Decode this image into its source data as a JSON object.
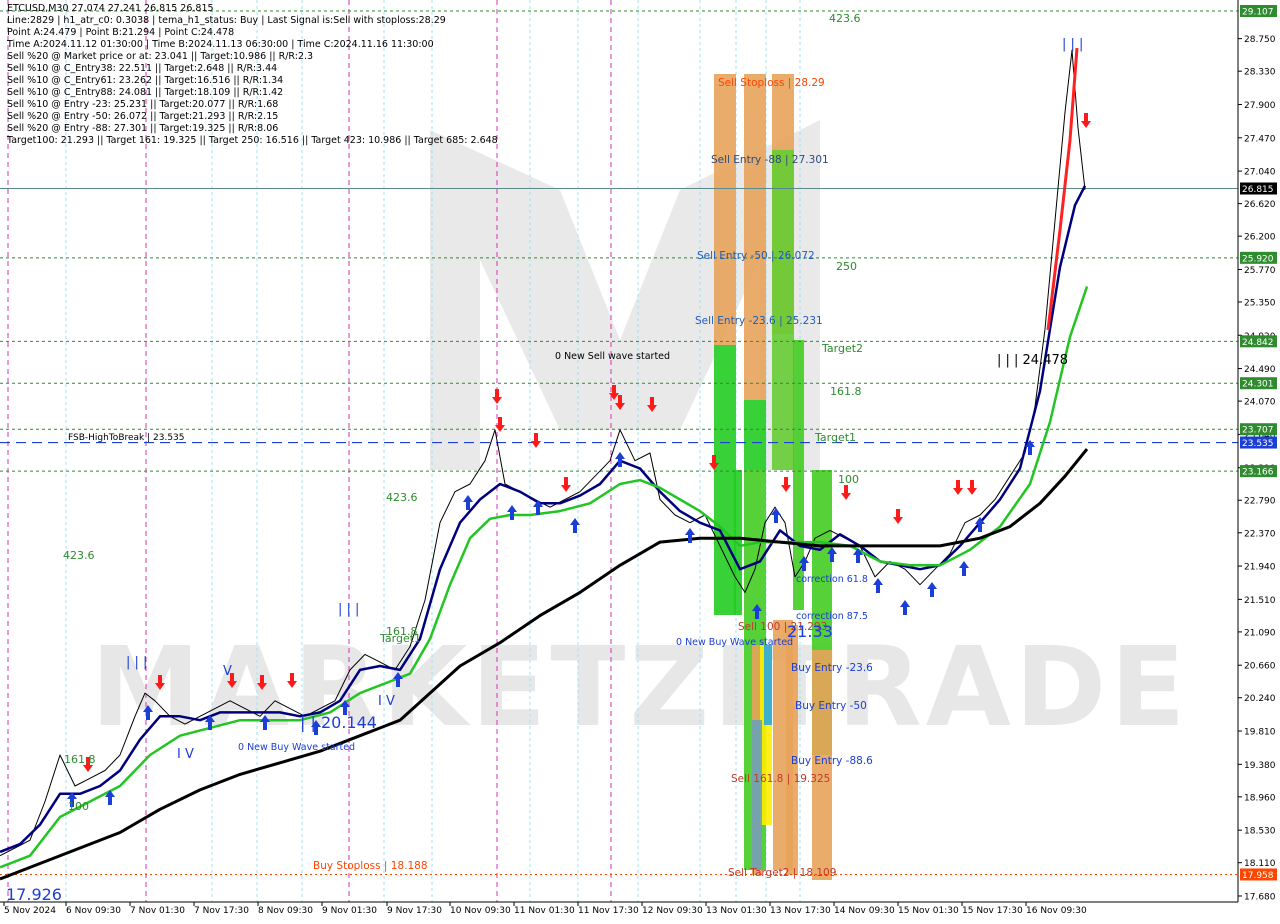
{
  "info_lines": [
    "ETCUSD,M30  27.074 27.241 26.815 26.815",
    "Line:2829  |  h1_atr_c0: 0.3038  |  tema_h1_status: Buy  |  Last Signal is:Sell with stoploss:28.29",
    "Point A:24.479  |  Point B:21.294  |  Point C:24.478",
    "Time A:2024.11.12 01:30:00  |  Time B:2024.11.13 06:30:00  |  Time C:2024.11.16 11:30:00",
    "Sell %20 @ Market price or at: 23.041  ||  Target:10.986  ||  R/R:2.3",
    "Sell %10 @ C_Entry38: 22.511  ||  Target:2.648  ||  R/R:3.44",
    "Sell %10 @ C_Entry61: 23.262  ||  Target:16.516  ||  R/R:1.34",
    "Sell %10 @ C_Entry88: 24.081  ||  Target:18.109  ||  R/R:1.42",
    "Sell %10 @ Entry -23: 25.231  ||  Target:20.077  ||  R/R:1.68",
    "Sell %20 @ Entry -50: 26.072  ||  Target:21.293  ||  R/R:2.15",
    "Sell %20 @ Entry -88: 27.301  ||  Target:19.325  ||  R/R:8.06",
    "Target100: 21.293  ||  Target 161: 19.325  ||  Target 250: 16.516  ||  Target 423: 10.986  ||  Target 685: 2.648"
  ],
  "chart_data": {
    "type": "line",
    "symbol": "ETCUSD,M30",
    "ylim": [
      17.68,
      29.107
    ],
    "y_ticks": [
      "28.750",
      "28.330",
      "27.900",
      "27.470",
      "27.040",
      "26.620",
      "26.200",
      "25.770",
      "25.350",
      "24.920",
      "24.490",
      "24.070",
      "23.640",
      "23.210",
      "22.790",
      "22.370",
      "21.940",
      "21.510",
      "21.090",
      "20.660",
      "20.240",
      "19.810",
      "19.380",
      "18.960",
      "18.530",
      "18.110",
      "17.680"
    ],
    "x_labels": [
      "5 Nov 2024",
      "6 Nov 09:30",
      "7 Nov 01:30",
      "7 Nov 17:30",
      "8 Nov 09:30",
      "9 Nov 01:30",
      "9 Nov 17:30",
      "10 Nov 09:30",
      "11 Nov 01:30",
      "11 Nov 17:30",
      "12 Nov 09:30",
      "13 Nov 01:30",
      "13 Nov 17:30",
      "14 Nov 09:30",
      "15 Nov 01:30",
      "15 Nov 17:30",
      "16 Nov 09:30"
    ],
    "price_badges": [
      {
        "value": "29.107",
        "color": "#2e8b2e"
      },
      {
        "value": "26.815",
        "color": "#000000"
      },
      {
        "value": "25.920",
        "color": "#2e8b2e"
      },
      {
        "value": "24.842",
        "color": "#2e8b2e"
      },
      {
        "value": "24.301",
        "color": "#2e8b2e"
      },
      {
        "value": "23.707",
        "color": "#2e8b2e"
      },
      {
        "value": "23.535",
        "color": "#1a3ed6"
      },
      {
        "value": "23.166",
        "color": "#2e8b2e"
      },
      {
        "value": "17.958",
        "color": "#ff4500"
      }
    ],
    "hlines": [
      {
        "value": 29.107,
        "style": "green-dotted"
      },
      {
        "value": 26.815,
        "style": "last-price"
      },
      {
        "value": 25.92,
        "style": "green-dotted"
      },
      {
        "value": 24.842,
        "style": "green-dotted"
      },
      {
        "value": 24.301,
        "style": "green-dotted"
      },
      {
        "value": 23.707,
        "style": "green-dotted"
      },
      {
        "value": 23.535,
        "style": "blue-dashed"
      },
      {
        "value": 23.166,
        "style": "green-dotted"
      },
      {
        "value": 17.958,
        "style": "orange-dotted"
      }
    ],
    "series": [
      {
        "name": "price",
        "color": "#000000",
        "values": [
          [
            0,
            18.2
          ],
          [
            15,
            18.3
          ],
          [
            30,
            18.4
          ],
          [
            45,
            18.9
          ],
          [
            60,
            19.5
          ],
          [
            75,
            19.1
          ],
          [
            90,
            19.2
          ],
          [
            105,
            19.3
          ],
          [
            120,
            19.5
          ],
          [
            135,
            20.0
          ],
          [
            145,
            20.3
          ],
          [
            155,
            20.2
          ],
          [
            170,
            20.0
          ],
          [
            185,
            19.9
          ],
          [
            200,
            20.0
          ],
          [
            215,
            20.1
          ],
          [
            230,
            20.2
          ],
          [
            245,
            20.1
          ],
          [
            260,
            20.0
          ],
          [
            275,
            20.2
          ],
          [
            290,
            20.1
          ],
          [
            305,
            20.0
          ],
          [
            320,
            20.1
          ],
          [
            335,
            20.2
          ],
          [
            350,
            20.6
          ],
          [
            365,
            20.8
          ],
          [
            380,
            20.7
          ],
          [
            395,
            20.6
          ],
          [
            410,
            20.9
          ],
          [
            425,
            21.5
          ],
          [
            440,
            22.5
          ],
          [
            455,
            22.9
          ],
          [
            470,
            23.0
          ],
          [
            485,
            23.3
          ],
          [
            495,
            23.7
          ],
          [
            505,
            23.0
          ],
          [
            520,
            22.9
          ],
          [
            535,
            22.8
          ],
          [
            550,
            22.7
          ],
          [
            565,
            22.8
          ],
          [
            580,
            22.9
          ],
          [
            595,
            23.1
          ],
          [
            610,
            23.3
          ],
          [
            620,
            23.7
          ],
          [
            635,
            23.3
          ],
          [
            650,
            23.4
          ],
          [
            660,
            22.8
          ],
          [
            675,
            22.6
          ],
          [
            690,
            22.5
          ],
          [
            705,
            22.6
          ],
          [
            720,
            22.2
          ],
          [
            735,
            21.8
          ],
          [
            745,
            21.6
          ],
          [
            755,
            21.9
          ],
          [
            765,
            22.5
          ],
          [
            775,
            22.7
          ],
          [
            785,
            22.5
          ],
          [
            795,
            21.8
          ],
          [
            805,
            22.0
          ],
          [
            815,
            22.3
          ],
          [
            830,
            22.4
          ],
          [
            845,
            22.3
          ],
          [
            860,
            22.2
          ],
          [
            875,
            21.8
          ],
          [
            890,
            22.0
          ],
          [
            905,
            21.9
          ],
          [
            920,
            21.7
          ],
          [
            935,
            21.9
          ],
          [
            950,
            22.1
          ],
          [
            965,
            22.5
          ],
          [
            980,
            22.6
          ],
          [
            995,
            22.8
          ],
          [
            1010,
            23.1
          ],
          [
            1025,
            23.4
          ],
          [
            1035,
            24.0
          ],
          [
            1045,
            25.0
          ],
          [
            1055,
            26.4
          ],
          [
            1065,
            27.8
          ],
          [
            1072,
            28.6
          ],
          [
            1078,
            27.6
          ],
          [
            1085,
            26.8
          ]
        ]
      },
      {
        "name": "ma-fast",
        "color": "#00007f",
        "values": [
          [
            0,
            18.25
          ],
          [
            20,
            18.35
          ],
          [
            40,
            18.6
          ],
          [
            60,
            19.0
          ],
          [
            80,
            19.0
          ],
          [
            100,
            19.1
          ],
          [
            120,
            19.3
          ],
          [
            140,
            19.7
          ],
          [
            160,
            20.0
          ],
          [
            180,
            20.0
          ],
          [
            200,
            19.95
          ],
          [
            220,
            20.05
          ],
          [
            240,
            20.05
          ],
          [
            260,
            20.05
          ],
          [
            280,
            20.05
          ],
          [
            300,
            20.0
          ],
          [
            320,
            20.05
          ],
          [
            340,
            20.2
          ],
          [
            360,
            20.6
          ],
          [
            380,
            20.65
          ],
          [
            400,
            20.6
          ],
          [
            420,
            21.0
          ],
          [
            440,
            21.9
          ],
          [
            460,
            22.5
          ],
          [
            480,
            22.8
          ],
          [
            500,
            23.0
          ],
          [
            520,
            22.9
          ],
          [
            540,
            22.75
          ],
          [
            560,
            22.75
          ],
          [
            580,
            22.85
          ],
          [
            600,
            23.0
          ],
          [
            620,
            23.3
          ],
          [
            640,
            23.2
          ],
          [
            660,
            22.9
          ],
          [
            680,
            22.65
          ],
          [
            700,
            22.5
          ],
          [
            720,
            22.4
          ],
          [
            740,
            21.9
          ],
          [
            760,
            22.0
          ],
          [
            780,
            22.4
          ],
          [
            800,
            22.2
          ],
          [
            820,
            22.15
          ],
          [
            840,
            22.35
          ],
          [
            860,
            22.2
          ],
          [
            880,
            22.0
          ],
          [
            900,
            21.95
          ],
          [
            920,
            21.9
          ],
          [
            940,
            21.95
          ],
          [
            960,
            22.2
          ],
          [
            980,
            22.5
          ],
          [
            1000,
            22.8
          ],
          [
            1020,
            23.2
          ],
          [
            1040,
            24.2
          ],
          [
            1060,
            25.8
          ],
          [
            1075,
            26.6
          ],
          [
            1085,
            26.85
          ]
        ]
      },
      {
        "name": "ma-mid",
        "color": "#22c522",
        "values": [
          [
            0,
            18.05
          ],
          [
            30,
            18.2
          ],
          [
            60,
            18.7
          ],
          [
            90,
            18.9
          ],
          [
            120,
            19.1
          ],
          [
            150,
            19.5
          ],
          [
            180,
            19.75
          ],
          [
            210,
            19.85
          ],
          [
            240,
            19.95
          ],
          [
            270,
            19.95
          ],
          [
            300,
            19.95
          ],
          [
            330,
            20.05
          ],
          [
            360,
            20.3
          ],
          [
            390,
            20.45
          ],
          [
            410,
            20.55
          ],
          [
            430,
            21.0
          ],
          [
            450,
            21.7
          ],
          [
            470,
            22.3
          ],
          [
            490,
            22.55
          ],
          [
            510,
            22.6
          ],
          [
            530,
            22.6
          ],
          [
            560,
            22.65
          ],
          [
            590,
            22.75
          ],
          [
            620,
            23.0
          ],
          [
            640,
            23.05
          ],
          [
            660,
            22.95
          ],
          [
            680,
            22.8
          ],
          [
            700,
            22.65
          ],
          [
            720,
            22.45
          ],
          [
            740,
            22.2
          ],
          [
            760,
            22.25
          ],
          [
            790,
            22.25
          ],
          [
            820,
            22.25
          ],
          [
            850,
            22.2
          ],
          [
            880,
            22.0
          ],
          [
            910,
            21.95
          ],
          [
            940,
            21.95
          ],
          [
            970,
            22.15
          ],
          [
            1000,
            22.45
          ],
          [
            1030,
            23.0
          ],
          [
            1050,
            23.8
          ],
          [
            1070,
            24.9
          ],
          [
            1087,
            25.55
          ]
        ]
      },
      {
        "name": "ma-slow",
        "color": "#000000",
        "values": [
          [
            0,
            17.9
          ],
          [
            40,
            18.1
          ],
          [
            80,
            18.3
          ],
          [
            120,
            18.5
          ],
          [
            160,
            18.8
          ],
          [
            200,
            19.05
          ],
          [
            240,
            19.25
          ],
          [
            280,
            19.4
          ],
          [
            320,
            19.55
          ],
          [
            360,
            19.75
          ],
          [
            400,
            19.95
          ],
          [
            430,
            20.3
          ],
          [
            460,
            20.65
          ],
          [
            500,
            20.95
          ],
          [
            540,
            21.3
          ],
          [
            580,
            21.6
          ],
          [
            620,
            21.95
          ],
          [
            660,
            22.25
          ],
          [
            700,
            22.3
          ],
          [
            740,
            22.3
          ],
          [
            780,
            22.25
          ],
          [
            820,
            22.2
          ],
          [
            860,
            22.2
          ],
          [
            900,
            22.2
          ],
          [
            940,
            22.2
          ],
          [
            980,
            22.3
          ],
          [
            1010,
            22.45
          ],
          [
            1040,
            22.75
          ],
          [
            1065,
            23.1
          ],
          [
            1087,
            23.45
          ]
        ]
      }
    ],
    "annotations": [
      {
        "text": "Sell Stoploss | 28.29",
        "color": "#ff4500"
      },
      {
        "text": "Sell Entry -88 | 27.301",
        "color": "#2e4a7a"
      },
      {
        "text": "Sell Entry -50 | 26.072",
        "color": "#1f5cba"
      },
      {
        "text": "Sell Entry -23.6 | 25.231",
        "color": "#1f5cba"
      },
      {
        "text": "Sell 100 | 21.293",
        "color": "#c0392b"
      },
      {
        "text": "Sell 161.8 | 19.325",
        "color": "#c0392b"
      },
      {
        "text": "Sell Target2 | 18.109",
        "color": "#c0392b"
      },
      {
        "text": "Buy Entry -23.6",
        "color": "#1a3ed6"
      },
      {
        "text": "Buy Entry -50",
        "color": "#1a3ed6"
      },
      {
        "text": "Buy Entry -88.6",
        "color": "#1a3ed6"
      },
      {
        "text": "correction 61.8",
        "color": "#1a3ed6"
      },
      {
        "text": "correction 87.5",
        "color": "#1a3ed6"
      },
      {
        "text": "Buy Stoploss | 18.188",
        "color": "#ff4500"
      },
      {
        "text": "FSB-HighToBreak | 23.535",
        "color": "#000000"
      },
      {
        "text": "0 New Sell wave started",
        "color": "#000000"
      },
      {
        "text": "0 New Buy Wave started",
        "color": "#1a3ed6"
      },
      {
        "text": "0 New Buy Wave started",
        "color": "#1a3ed6"
      },
      {
        "text": "423.6",
        "color": "#2e8b2e"
      },
      {
        "text": "250",
        "color": "#2e8b2e"
      },
      {
        "text": "Target2",
        "color": "#2e8b2e"
      },
      {
        "text": "161.8",
        "color": "#2e8b2e"
      },
      {
        "text": "Target1",
        "color": "#2e8b2e"
      },
      {
        "text": "100",
        "color": "#2e8b2e"
      },
      {
        "text": "423.6",
        "color": "#2e8b2e"
      },
      {
        "text": "423.6",
        "color": "#2e8b2e"
      },
      {
        "text": "161.8",
        "color": "#2e8b2e"
      },
      {
        "text": "161.8",
        "color": "#2e8b2e"
      },
      {
        "text": "Target1",
        "color": "#2e8b2e"
      },
      {
        "text": "100",
        "color": "#2e8b2e"
      },
      {
        "text": "| | | 24.478",
        "color": "#000000"
      },
      {
        "text": "| | |",
        "color": "#1a3ed6"
      },
      {
        "text": "| | |",
        "color": "#1a3ed6"
      },
      {
        "text": "| | |",
        "color": "#1a3ed6"
      },
      {
        "text": "V",
        "color": "#1a3ed6"
      },
      {
        "text": "I V",
        "color": "#1a3ed6"
      },
      {
        "text": "I V",
        "color": "#1a3ed6"
      },
      {
        "text": "| | 20.144",
        "color": "#1a3ed6"
      },
      {
        "text": "21.33",
        "color": "#1a3ed6"
      },
      {
        "text": "17.926",
        "color": "#1a3ed6"
      }
    ],
    "watermark": "MARKETZITRADE"
  }
}
